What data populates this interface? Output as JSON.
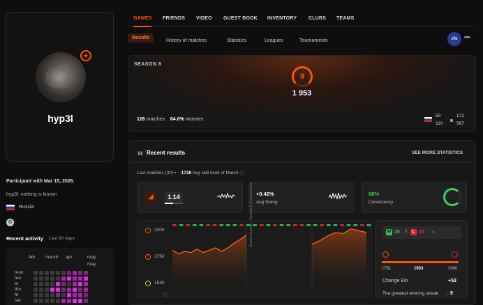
{
  "profile": {
    "nickname": "hyp3l",
    "participant": "Participant with Mar 15, 2026.",
    "bio": "hyp3l: nothing is known",
    "country": "Russia"
  },
  "activity": {
    "title": "Recent activity",
    "period": "Last 90 days",
    "months": [
      "feb.",
      "march",
      "apr.",
      "may",
      "may"
    ],
    "days": [
      "mon",
      "tue",
      "sr",
      "thu",
      "fri",
      "sat"
    ],
    "grid_levels": [
      [
        0,
        0,
        0,
        0,
        0,
        0,
        1,
        2,
        1,
        1
      ],
      [
        0,
        0,
        0,
        0,
        0,
        2,
        3,
        2,
        2,
        3
      ],
      [
        0,
        0,
        0,
        0,
        3,
        1,
        0,
        2,
        3,
        2
      ],
      [
        0,
        0,
        0,
        3,
        3,
        1,
        2,
        3,
        1,
        2
      ],
      [
        0,
        0,
        0,
        0,
        1,
        0,
        3,
        2,
        2,
        1
      ],
      [
        0,
        0,
        0,
        0,
        0,
        2,
        2,
        3,
        3,
        1
      ]
    ],
    "level_colors": [
      "#3a3a3a",
      "#7a2a7a",
      "#b020b0",
      "#e02ee0"
    ]
  },
  "nav": {
    "tabs": [
      "GAMES",
      "FRIENDS",
      "VIDEO",
      "GUEST BOOK",
      "INVENTORY",
      "CLUBS",
      "TEAMS"
    ],
    "subtabs": [
      "Results",
      "History of matches",
      "Statistics",
      "Leagues",
      "Tournaments"
    ],
    "logo": "cfs",
    "more": "•••"
  },
  "season": {
    "label": "SEASON 8",
    "level": "9",
    "elo": "1 953",
    "matches_count": "126",
    "matches_label": "matches",
    "victories_pct": "64.0%",
    "victories_label": "victories",
    "flag1_top": "50",
    "flag1_bottom": "110",
    "flag2_top": "171",
    "flag2_bottom": "567"
  },
  "recent": {
    "title": "Recent results",
    "see_more": "SEE MORE STATISTICS",
    "last_matches": "Last matches (30) •",
    "avg_elo": "1728",
    "avg_label": "Avg skill level of Match",
    "kd": "1.14",
    "swing_value": "+0.42%",
    "swing_label": "Avg Swing",
    "consistency_value": "68%",
    "consistency_label": "Consistency",
    "consistency_fraction": 0.68
  },
  "chart_data": {
    "type": "area",
    "yticks": [
      "2000",
      "1750",
      "1530"
    ],
    "ylim": [
      1530,
      2000
    ],
    "segment1": [
      1810,
      1780,
      1800,
      1790,
      1820,
      1790,
      1810,
      1830,
      1800,
      1830,
      1870,
      1900,
      1940
    ],
    "segment2": [
      1860,
      1890,
      1930,
      1960,
      1950,
      1990,
      1975,
      1960
    ],
    "split_label": "Season change • Season 8 of parameters",
    "results": [
      "L",
      "W",
      "L",
      "W",
      "W",
      "L",
      "L",
      "W",
      "W",
      "W",
      "L",
      "W",
      "W",
      "L",
      "W",
      "L",
      "W",
      "W",
      "L",
      "L",
      "W",
      "W",
      "L",
      "W",
      "W",
      "L",
      "W",
      "W",
      "L",
      "W"
    ],
    "result_colors": {
      "W": "#36c352",
      "L": "#d8263b"
    }
  },
  "panel": {
    "wins": "15",
    "losses": "15",
    "elo_min": "1751",
    "elo_cur": "1953",
    "elo_max": "2000",
    "change_label": "Change Elo",
    "change_value": "+53",
    "streak_label": "The greatest winning streak",
    "streak_value": "5"
  }
}
